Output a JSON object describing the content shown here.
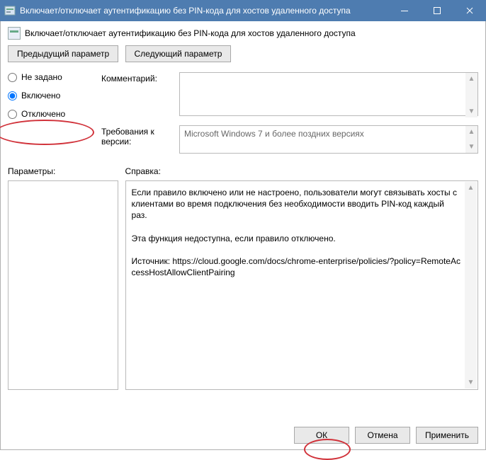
{
  "window": {
    "title": "Включает/отключает аутентификацию без PIN-кода для хостов удаленного доступа"
  },
  "header": {
    "title": "Включает/отключает аутентификацию без PIN-кода для хостов удаленного доступа"
  },
  "nav": {
    "prev": "Предыдущий параметр",
    "next": "Следующий параметр"
  },
  "radios": {
    "not_configured": "Не задано",
    "enabled": "Включено",
    "disabled": "Отключено",
    "selected": "enabled"
  },
  "fields": {
    "comment_label": "Комментарий:",
    "comment_value": "",
    "version_label": "Требования к версии:",
    "version_value": "Microsoft Windows 7 и более поздних версиях"
  },
  "lower": {
    "params_label": "Параметры:",
    "help_label": "Справка:",
    "help_text_p1": "Если правило включено или не настроено, пользователи могут связывать хосты с клиентами во время подключения без необходимости вводить PIN-код каждый раз.",
    "help_text_p2": "Эта функция недоступна, если правило отключено.",
    "help_text_p3": "Источник: https://cloud.google.com/docs/chrome-enterprise/policies/?policy=RemoteAccessHostAllowClientPairing"
  },
  "buttons": {
    "ok": "ОК",
    "cancel": "Отмена",
    "apply": "Применить"
  },
  "icons": {
    "app": "gpedit-icon",
    "minimize": "minimize-icon",
    "maximize": "maximize-icon",
    "close": "close-icon"
  }
}
